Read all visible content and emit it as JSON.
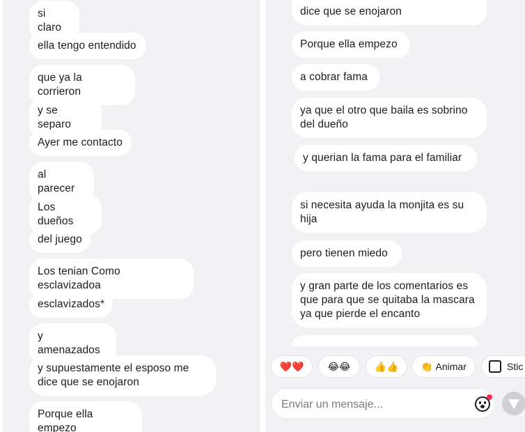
{
  "left_messages": [
    "si claro",
    "ella tengo entendido",
    "que ya la corrieron",
    "y se separo",
    "Ayer me contacto",
    "al parecer",
    "Los dueños",
    "del juego",
    "Los tenian Como esclavizadoa",
    "esclavizados*",
    "y amenazados",
    "y supuestamente el esposo me dice que se enojaron",
    "Porque ella empezo"
  ],
  "right_messages": [
    "dice que se enojaron",
    "Porque ella empezo",
    "a cobrar fama",
    "ya que el otro que baila es sobrino del dueño",
    "y querian la fama para el familiar",
    "si necesita ayuda la monjita es su hija",
    "pero tienen miedo",
    "y gran parte de los comentarios es que para que se quitaba la mascara ya que pierde el encanto"
  ],
  "reactions": [
    {
      "emoji": "❤️❤️",
      "label": ""
    },
    {
      "emoji": "😂😂",
      "label": ""
    },
    {
      "emoji": "👍👍",
      "label": ""
    },
    {
      "emoji": "👏",
      "label": "Animar"
    },
    {
      "emoji": "🗒",
      "label": "Stic"
    }
  ],
  "composer": {
    "placeholder": "Enviar un mensaje..."
  },
  "colors": {
    "background": "#f2f2f4",
    "bubble": "#ffffff",
    "text": "#1c1c1e",
    "notification_dot": "#ff2a55",
    "send_button": "#cfd0d4"
  }
}
